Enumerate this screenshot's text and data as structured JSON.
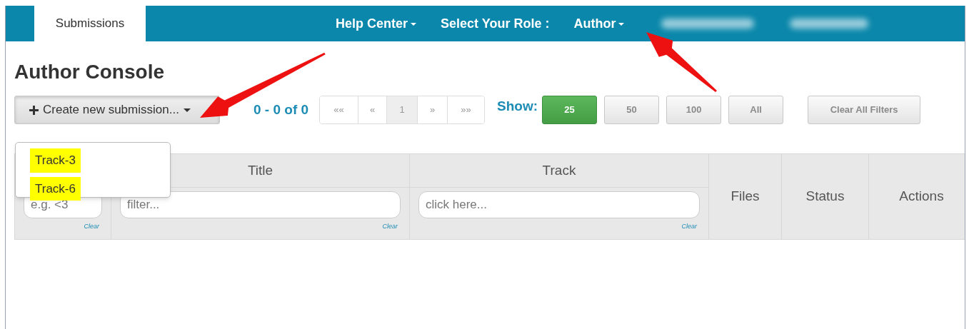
{
  "navbar": {
    "tabs": [
      {
        "label": "Submissions",
        "selected": true
      }
    ],
    "menus": [
      {
        "label": "Help Center",
        "kind": "dropdown"
      },
      {
        "label": "Select Your Role :",
        "kind": "label"
      },
      {
        "label": "Author",
        "kind": "dropdown"
      }
    ]
  },
  "page_title": "Author Console",
  "create_button": {
    "label": "Create new submission...",
    "expanded": true
  },
  "create_menu": {
    "items": [
      {
        "label": "Track-3",
        "highlighted": true
      },
      {
        "label": "Track-6",
        "highlighted": true
      }
    ]
  },
  "range": "0 - 0 of 0",
  "pager": [
    {
      "label": "««",
      "selected": false
    },
    {
      "label": "«",
      "selected": false
    },
    {
      "label": "1",
      "selected": true
    },
    {
      "label": "»",
      "selected": false
    },
    {
      "label": "»»",
      "selected": false
    }
  ],
  "show_label": "Show:",
  "page_sizes": [
    {
      "label": "25",
      "selected": true
    },
    {
      "label": "50",
      "selected": false
    },
    {
      "label": "100",
      "selected": false
    },
    {
      "label": "All",
      "selected": false
    }
  ],
  "clear_filters": "Clear All Filters",
  "table": {
    "columns": [
      {
        "filter": {
          "placeholder": "e.g. <3",
          "clear": "Clear"
        }
      },
      {
        "header": "Title",
        "filter": {
          "placeholder": "filter...",
          "clear": "Clear"
        }
      },
      {
        "header": "Track",
        "filter": {
          "placeholder": "click here...",
          "clear": "Clear"
        }
      },
      {
        "header": "Files"
      },
      {
        "header": "Status"
      },
      {
        "header": "Actions"
      }
    ]
  }
}
